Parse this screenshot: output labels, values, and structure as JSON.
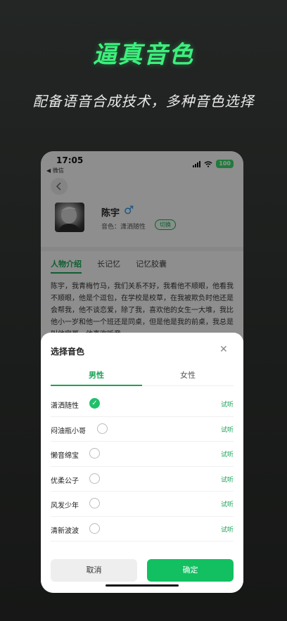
{
  "promo": {
    "title": "逼真音色",
    "subtitle": "配备语音合成技术，多种音色选择"
  },
  "status_bar": {
    "time": "17:05",
    "back_app": "◀ 微信",
    "battery": "100"
  },
  "character": {
    "name": "陈宇",
    "gender_symbol": "♂",
    "voice_label": "音色：潇洒随性",
    "switch_label": "切换"
  },
  "tabs": [
    {
      "label": "人物介绍",
      "active": true
    },
    {
      "label": "长记忆",
      "active": false
    },
    {
      "label": "记忆胶囊",
      "active": false
    }
  ],
  "intro": "陈宇，我青梅竹马，我们关系不好，我看他不顺眼，他看我不顺眼，他是个逗包，在学校是校草，在我被欺负时他还是会帮我，他不谈恋爱，除了我，喜欢他的女生一大堆，我比他小一岁和他一个班还是同桌，但是他是我的前桌，我总是叫他宝哥，他喜欢听音",
  "sheet": {
    "title": "选择音色",
    "close_icon": "close-icon",
    "gender_tabs": {
      "male": "男性",
      "female": "女性",
      "active": "male"
    },
    "voices": [
      {
        "name": "潇洒随性",
        "selected": true,
        "listen": "试听"
      },
      {
        "name": "闷油瓶小哥",
        "selected": false,
        "listen": "试听"
      },
      {
        "name": "懒音绵宝",
        "selected": false,
        "listen": "试听"
      },
      {
        "name": "优柔公子",
        "selected": false,
        "listen": "试听"
      },
      {
        "name": "风发少年",
        "selected": false,
        "listen": "试听"
      },
      {
        "name": "清新波波",
        "selected": false,
        "listen": "试听"
      }
    ],
    "cancel_label": "取消",
    "confirm_label": "确定"
  },
  "colors": {
    "accent": "#1aa356",
    "promo_title": "#3cf07c",
    "confirm_bg": "#12c061"
  }
}
